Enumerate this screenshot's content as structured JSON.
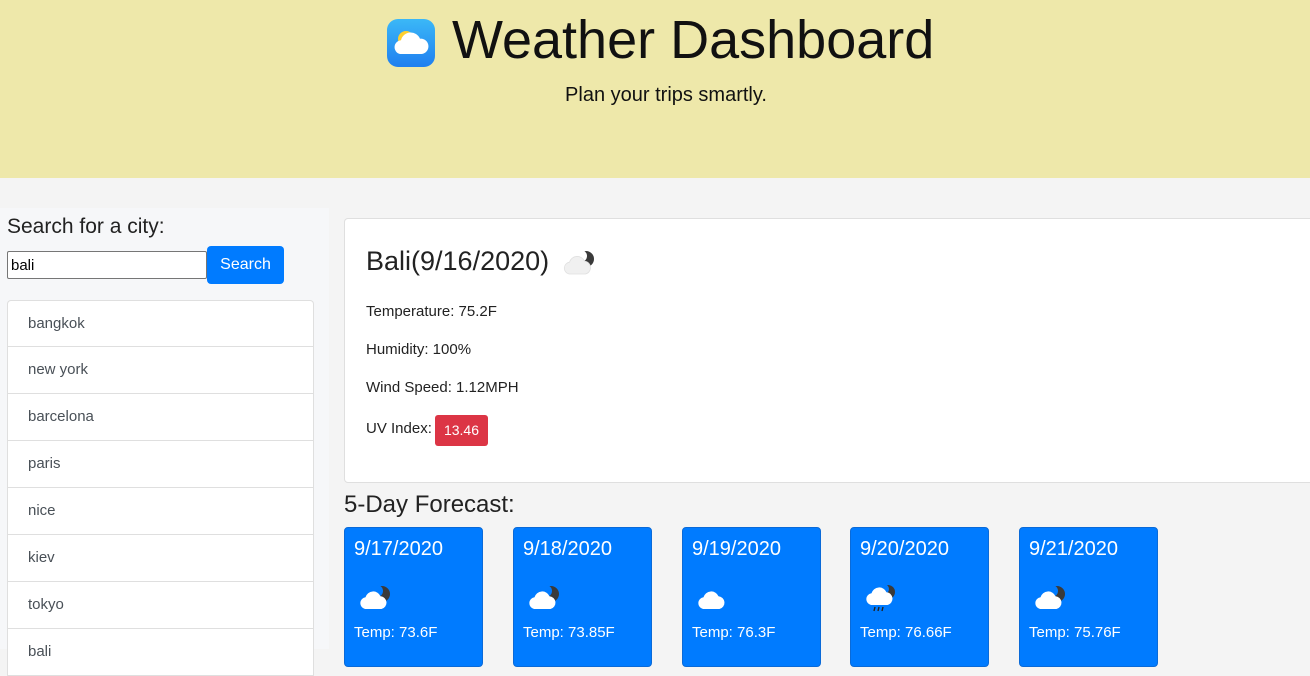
{
  "header": {
    "title": "Weather Dashboard",
    "subtitle": "Plan your trips smartly.",
    "app_icon": "partly-cloudy-app-icon",
    "background_color": "#eee8aa"
  },
  "search": {
    "label": "Search for a city:",
    "input_value": "bali",
    "button_label": "Search",
    "button_color": "#007bff"
  },
  "history": {
    "cities": [
      "bangkok",
      "new york",
      "barcelona",
      "paris",
      "nice",
      "kiev",
      "tokyo",
      "bali"
    ]
  },
  "current": {
    "title": "Bali(9/16/2020)",
    "icon": "partly-cloudy-night-icon",
    "temperature": "Temperature: 75.2F",
    "humidity": "Humidity: 100%",
    "wind": "Wind Speed: 1.12MPH",
    "uv_label": "UV Index:",
    "uv_value": "13.46",
    "uv_color": "#dc3545"
  },
  "forecast": {
    "title": "5-Day Forecast:",
    "days": [
      {
        "date": "9/17/2020",
        "icon": "partly-cloudy-night-icon",
        "temp": "Temp: 73.6F"
      },
      {
        "date": "9/18/2020",
        "icon": "partly-cloudy-night-icon",
        "temp": "Temp: 73.85F"
      },
      {
        "date": "9/19/2020",
        "icon": "cloud-icon",
        "temp": "Temp: 76.3F"
      },
      {
        "date": "9/20/2020",
        "icon": "rain-cloud-night-icon",
        "temp": "Temp: 76.66F"
      },
      {
        "date": "9/21/2020",
        "icon": "partly-cloudy-night-icon",
        "temp": "Temp: 75.76F"
      }
    ],
    "card_color": "#007bff"
  }
}
